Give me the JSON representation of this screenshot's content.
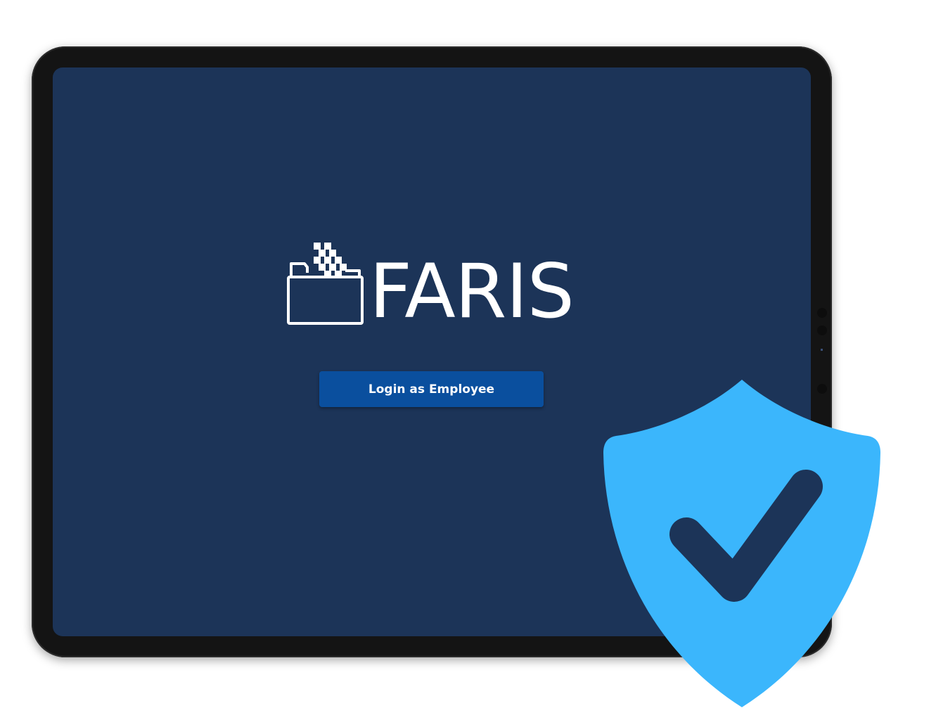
{
  "brand": {
    "name": "FARIS",
    "logo_icon": "folder-checker-icon"
  },
  "login": {
    "button_label": "Login as Employee"
  },
  "overlay": {
    "icon": "shield-check-icon"
  },
  "colors": {
    "screen_background": "#1c3458",
    "button_background": "#0a4f9e",
    "shield": "#3bb6fc",
    "check": "#1c3458",
    "device_frame": "#141414"
  }
}
